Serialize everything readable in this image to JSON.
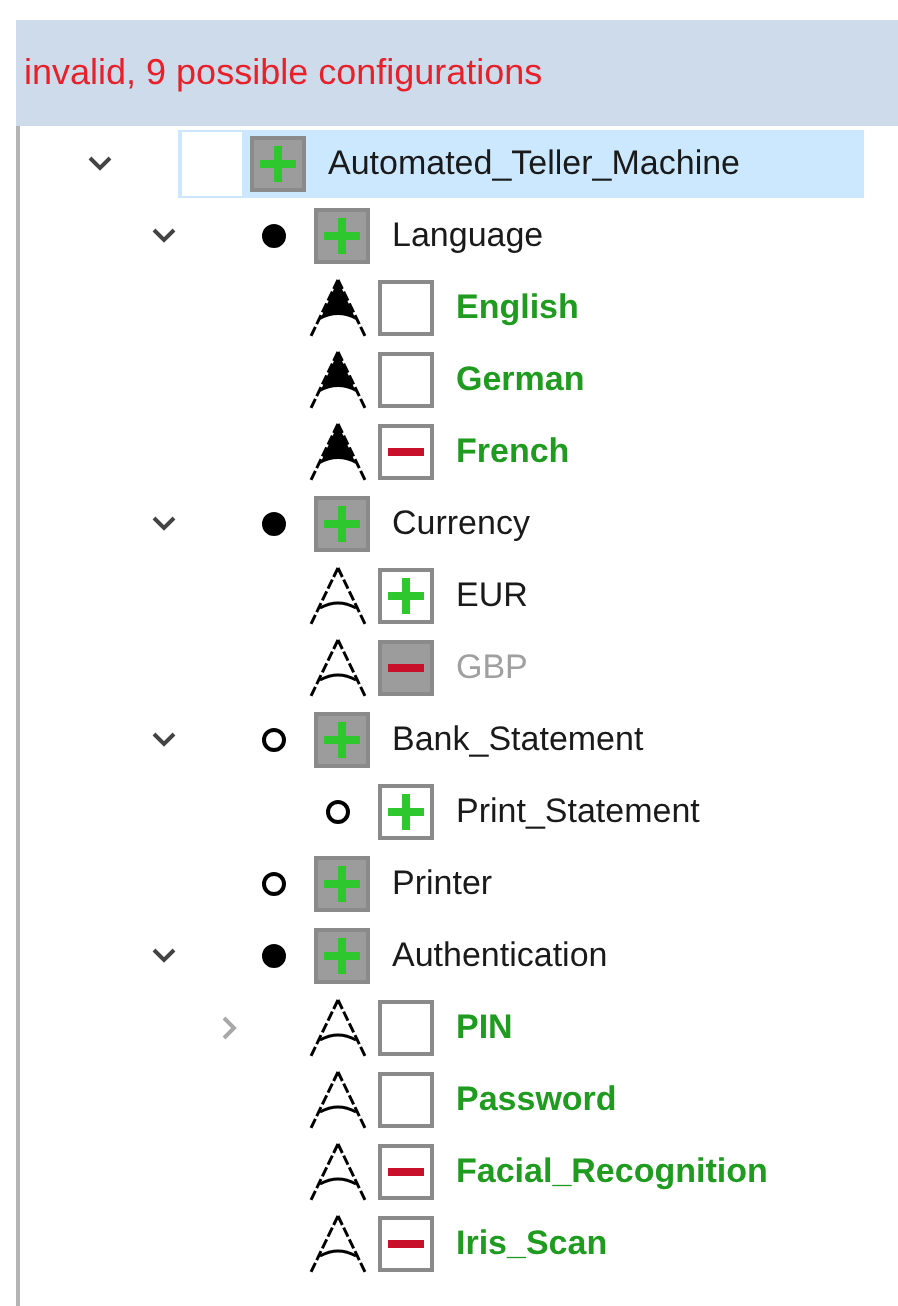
{
  "status_message": "invalid, 9 possible configurations",
  "tree": [
    {
      "label": "Automated_Teller_Machine",
      "kind": "root",
      "expanded": true,
      "selected": true,
      "included": true,
      "excluded": false,
      "locked": true,
      "suggested": false,
      "disabled": false,
      "children": [
        {
          "label": "Language",
          "kind": "mandatory",
          "expanded": true,
          "selected": false,
          "included": true,
          "excluded": false,
          "locked": true,
          "suggested": false,
          "disabled": false,
          "children": [
            {
              "label": "English",
              "kind": "alternative",
              "selected": false,
              "included": false,
              "excluded": false,
              "locked": false,
              "suggested": true,
              "disabled": false
            },
            {
              "label": "German",
              "kind": "alternative",
              "selected": false,
              "included": false,
              "excluded": false,
              "locked": false,
              "suggested": true,
              "disabled": false
            },
            {
              "label": "French",
              "kind": "alternative",
              "selected": false,
              "included": false,
              "excluded": true,
              "locked": false,
              "suggested": true,
              "disabled": false
            }
          ]
        },
        {
          "label": "Currency",
          "kind": "mandatory",
          "expanded": true,
          "selected": false,
          "included": true,
          "excluded": false,
          "locked": true,
          "suggested": false,
          "disabled": false,
          "children": [
            {
              "label": "EUR",
              "kind": "or",
              "selected": false,
              "included": true,
              "excluded": false,
              "locked": false,
              "suggested": false,
              "disabled": false
            },
            {
              "label": "GBP",
              "kind": "or",
              "selected": false,
              "included": false,
              "excluded": true,
              "locked": true,
              "suggested": false,
              "disabled": true
            }
          ]
        },
        {
          "label": "Bank_Statement",
          "kind": "optional",
          "expanded": true,
          "selected": false,
          "included": true,
          "excluded": false,
          "locked": true,
          "suggested": false,
          "disabled": false,
          "children": [
            {
              "label": "Print_Statement",
              "kind": "optional",
              "selected": false,
              "included": true,
              "excluded": false,
              "locked": false,
              "suggested": false,
              "disabled": false
            }
          ]
        },
        {
          "label": "Printer",
          "kind": "optional",
          "selected": false,
          "included": true,
          "excluded": false,
          "locked": true,
          "suggested": false,
          "disabled": false
        },
        {
          "label": "Authentication",
          "kind": "mandatory",
          "expanded": true,
          "selected": false,
          "included": true,
          "excluded": false,
          "locked": true,
          "suggested": false,
          "disabled": false,
          "children": [
            {
              "label": "PIN",
              "kind": "or",
              "expanded": false,
              "selected": false,
              "included": false,
              "excluded": false,
              "locked": false,
              "suggested": true,
              "disabled": false
            },
            {
              "label": "Password",
              "kind": "or",
              "selected": false,
              "included": false,
              "excluded": false,
              "locked": false,
              "suggested": true,
              "disabled": false
            },
            {
              "label": "Facial_Recognition",
              "kind": "or",
              "selected": false,
              "included": false,
              "excluded": true,
              "locked": false,
              "suggested": true,
              "disabled": false
            },
            {
              "label": "Iris_Scan",
              "kind": "or",
              "selected": false,
              "included": false,
              "excluded": true,
              "locked": false,
              "suggested": true,
              "disabled": false
            }
          ]
        }
      ]
    }
  ]
}
